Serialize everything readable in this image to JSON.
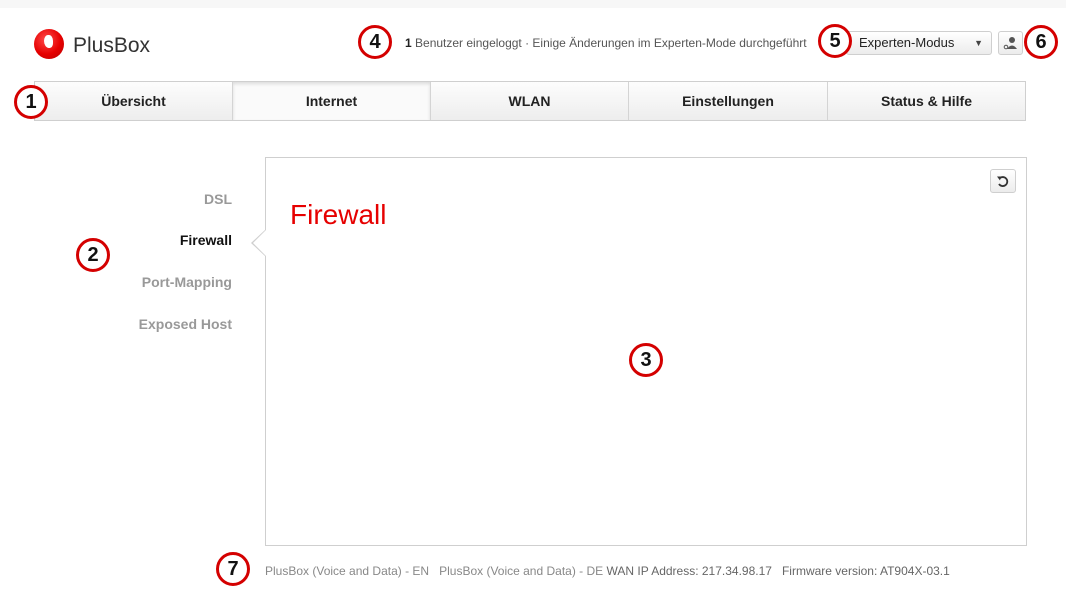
{
  "app": {
    "brand": "PlusBox",
    "status": {
      "count": "1",
      "text": " Benutzer eingeloggt · Einige Änderungen im Experten-Mode durchgeführt"
    },
    "mode_select": {
      "value": "Experten-Modus"
    }
  },
  "nav": {
    "tabs": [
      {
        "label": "Übersicht"
      },
      {
        "label": "Internet"
      },
      {
        "label": "WLAN"
      },
      {
        "label": "Einstellungen"
      },
      {
        "label": "Status & Hilfe"
      }
    ],
    "active": "Internet"
  },
  "sidebar": {
    "items": [
      {
        "label": "DSL"
      },
      {
        "label": "Firewall"
      },
      {
        "label": "Port-Mapping"
      },
      {
        "label": "Exposed Host"
      }
    ],
    "active": "Firewall"
  },
  "main": {
    "title": "Firewall"
  },
  "footer": {
    "link_en": "PlusBox (Voice and Data) - EN",
    "link_de": "PlusBox (Voice and Data) - DE",
    "wan": "WAN IP Address: 217.34.98.17",
    "firmware": "Firmware version: AT904X-03.1"
  },
  "markers": [
    "1",
    "2",
    "3",
    "4",
    "5",
    "6",
    "7"
  ],
  "colors": {
    "accent": "#e60000",
    "marker": "#d40000"
  },
  "icons": {
    "logo": "vodafone-logo-icon",
    "user": "user-icon",
    "refresh": "refresh-icon",
    "dropdown": "chevron-down-icon"
  }
}
